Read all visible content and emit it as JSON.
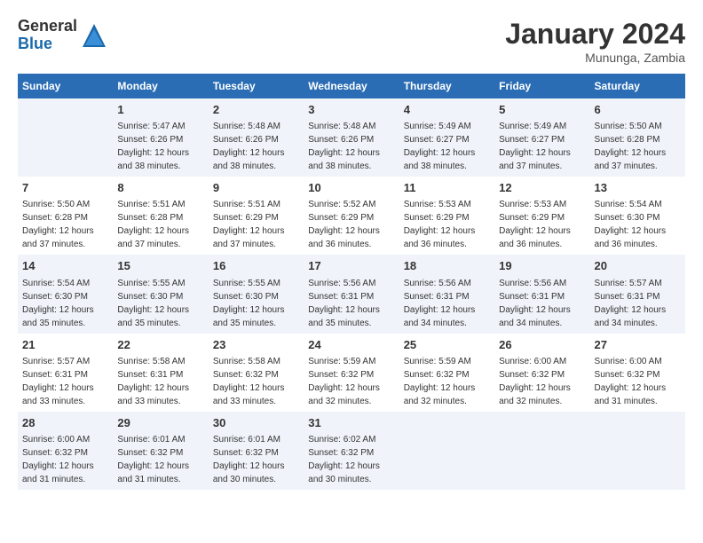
{
  "header": {
    "logo_general": "General",
    "logo_blue": "Blue",
    "title": "January 2024",
    "location": "Mununga, Zambia"
  },
  "days_of_week": [
    "Sunday",
    "Monday",
    "Tuesday",
    "Wednesday",
    "Thursday",
    "Friday",
    "Saturday"
  ],
  "weeks": [
    [
      {
        "day": "",
        "info": ""
      },
      {
        "day": "1",
        "info": "Sunrise: 5:47 AM\nSunset: 6:26 PM\nDaylight: 12 hours\nand 38 minutes."
      },
      {
        "day": "2",
        "info": "Sunrise: 5:48 AM\nSunset: 6:26 PM\nDaylight: 12 hours\nand 38 minutes."
      },
      {
        "day": "3",
        "info": "Sunrise: 5:48 AM\nSunset: 6:26 PM\nDaylight: 12 hours\nand 38 minutes."
      },
      {
        "day": "4",
        "info": "Sunrise: 5:49 AM\nSunset: 6:27 PM\nDaylight: 12 hours\nand 38 minutes."
      },
      {
        "day": "5",
        "info": "Sunrise: 5:49 AM\nSunset: 6:27 PM\nDaylight: 12 hours\nand 37 minutes."
      },
      {
        "day": "6",
        "info": "Sunrise: 5:50 AM\nSunset: 6:28 PM\nDaylight: 12 hours\nand 37 minutes."
      }
    ],
    [
      {
        "day": "7",
        "info": "Sunrise: 5:50 AM\nSunset: 6:28 PM\nDaylight: 12 hours\nand 37 minutes."
      },
      {
        "day": "8",
        "info": "Sunrise: 5:51 AM\nSunset: 6:28 PM\nDaylight: 12 hours\nand 37 minutes."
      },
      {
        "day": "9",
        "info": "Sunrise: 5:51 AM\nSunset: 6:29 PM\nDaylight: 12 hours\nand 37 minutes."
      },
      {
        "day": "10",
        "info": "Sunrise: 5:52 AM\nSunset: 6:29 PM\nDaylight: 12 hours\nand 36 minutes."
      },
      {
        "day": "11",
        "info": "Sunrise: 5:53 AM\nSunset: 6:29 PM\nDaylight: 12 hours\nand 36 minutes."
      },
      {
        "day": "12",
        "info": "Sunrise: 5:53 AM\nSunset: 6:29 PM\nDaylight: 12 hours\nand 36 minutes."
      },
      {
        "day": "13",
        "info": "Sunrise: 5:54 AM\nSunset: 6:30 PM\nDaylight: 12 hours\nand 36 minutes."
      }
    ],
    [
      {
        "day": "14",
        "info": "Sunrise: 5:54 AM\nSunset: 6:30 PM\nDaylight: 12 hours\nand 35 minutes."
      },
      {
        "day": "15",
        "info": "Sunrise: 5:55 AM\nSunset: 6:30 PM\nDaylight: 12 hours\nand 35 minutes."
      },
      {
        "day": "16",
        "info": "Sunrise: 5:55 AM\nSunset: 6:30 PM\nDaylight: 12 hours\nand 35 minutes."
      },
      {
        "day": "17",
        "info": "Sunrise: 5:56 AM\nSunset: 6:31 PM\nDaylight: 12 hours\nand 35 minutes."
      },
      {
        "day": "18",
        "info": "Sunrise: 5:56 AM\nSunset: 6:31 PM\nDaylight: 12 hours\nand 34 minutes."
      },
      {
        "day": "19",
        "info": "Sunrise: 5:56 AM\nSunset: 6:31 PM\nDaylight: 12 hours\nand 34 minutes."
      },
      {
        "day": "20",
        "info": "Sunrise: 5:57 AM\nSunset: 6:31 PM\nDaylight: 12 hours\nand 34 minutes."
      }
    ],
    [
      {
        "day": "21",
        "info": "Sunrise: 5:57 AM\nSunset: 6:31 PM\nDaylight: 12 hours\nand 33 minutes."
      },
      {
        "day": "22",
        "info": "Sunrise: 5:58 AM\nSunset: 6:31 PM\nDaylight: 12 hours\nand 33 minutes."
      },
      {
        "day": "23",
        "info": "Sunrise: 5:58 AM\nSunset: 6:32 PM\nDaylight: 12 hours\nand 33 minutes."
      },
      {
        "day": "24",
        "info": "Sunrise: 5:59 AM\nSunset: 6:32 PM\nDaylight: 12 hours\nand 32 minutes."
      },
      {
        "day": "25",
        "info": "Sunrise: 5:59 AM\nSunset: 6:32 PM\nDaylight: 12 hours\nand 32 minutes."
      },
      {
        "day": "26",
        "info": "Sunrise: 6:00 AM\nSunset: 6:32 PM\nDaylight: 12 hours\nand 32 minutes."
      },
      {
        "day": "27",
        "info": "Sunrise: 6:00 AM\nSunset: 6:32 PM\nDaylight: 12 hours\nand 31 minutes."
      }
    ],
    [
      {
        "day": "28",
        "info": "Sunrise: 6:00 AM\nSunset: 6:32 PM\nDaylight: 12 hours\nand 31 minutes."
      },
      {
        "day": "29",
        "info": "Sunrise: 6:01 AM\nSunset: 6:32 PM\nDaylight: 12 hours\nand 31 minutes."
      },
      {
        "day": "30",
        "info": "Sunrise: 6:01 AM\nSunset: 6:32 PM\nDaylight: 12 hours\nand 30 minutes."
      },
      {
        "day": "31",
        "info": "Sunrise: 6:02 AM\nSunset: 6:32 PM\nDaylight: 12 hours\nand 30 minutes."
      },
      {
        "day": "",
        "info": ""
      },
      {
        "day": "",
        "info": ""
      },
      {
        "day": "",
        "info": ""
      }
    ]
  ]
}
